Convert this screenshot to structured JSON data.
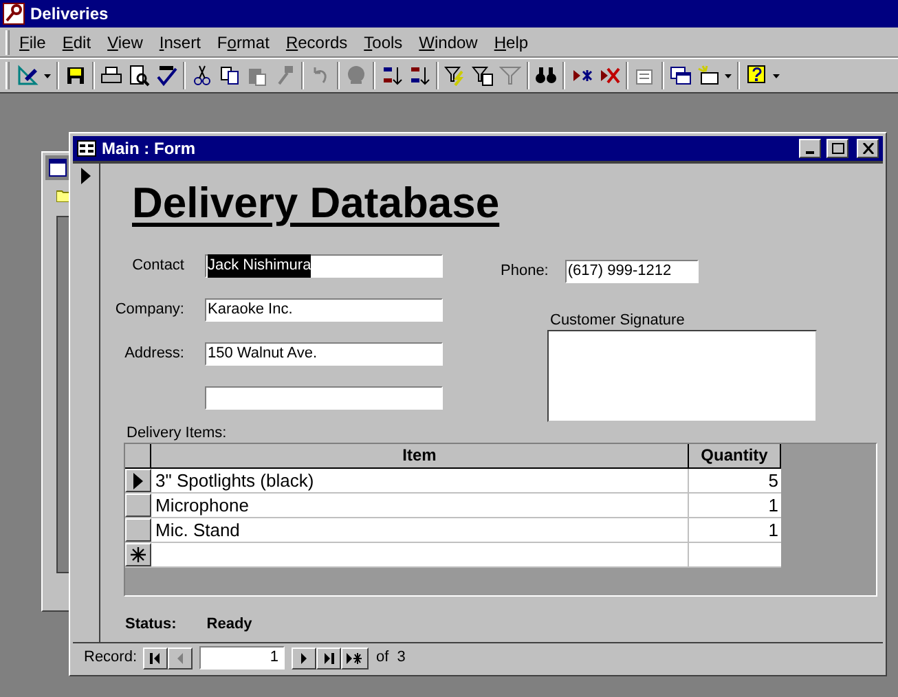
{
  "app": {
    "title": "Deliveries"
  },
  "menu": [
    {
      "accel": "F",
      "after": "ile"
    },
    {
      "accel": "E",
      "after": "dit"
    },
    {
      "accel": "V",
      "after": "iew"
    },
    {
      "accel": "I",
      "after": "nsert"
    },
    {
      "before": "F",
      "accel": "o",
      "after": "rmat"
    },
    {
      "accel": "R",
      "after": "ecords"
    },
    {
      "accel": "T",
      "after": "ools"
    },
    {
      "accel": "W",
      "after": "indow"
    },
    {
      "accel": "H",
      "after": "elp"
    }
  ],
  "toolbar": [
    [
      {
        "kind": "design",
        "disabled": false,
        "menu": true
      }
    ],
    [
      {
        "kind": "save",
        "disabled": false,
        "menu": false
      }
    ],
    [
      {
        "kind": "print",
        "disabled": false,
        "menu": false
      },
      {
        "kind": "preview",
        "disabled": false,
        "menu": false
      },
      {
        "kind": "spelling",
        "disabled": false,
        "menu": false
      }
    ],
    [
      {
        "kind": "cut",
        "disabled": false,
        "menu": false
      },
      {
        "kind": "copy",
        "disabled": false,
        "menu": false
      },
      {
        "kind": "paste",
        "disabled": true,
        "menu": false
      },
      {
        "kind": "painter",
        "disabled": true,
        "menu": false
      }
    ],
    [
      {
        "kind": "undo",
        "disabled": true,
        "menu": false
      }
    ],
    [
      {
        "kind": "hyperlink",
        "disabled": true,
        "menu": false
      }
    ],
    [
      {
        "kind": "sort-asc",
        "disabled": false,
        "menu": false
      },
      {
        "kind": "sort-desc",
        "disabled": false,
        "menu": false
      }
    ],
    [
      {
        "kind": "filter-selection",
        "disabled": false,
        "menu": false
      },
      {
        "kind": "filter-form",
        "disabled": false,
        "menu": false
      },
      {
        "kind": "apply-filter",
        "disabled": true,
        "menu": false
      }
    ],
    [
      {
        "kind": "find",
        "disabled": false,
        "menu": false
      }
    ],
    [
      {
        "kind": "new-record",
        "disabled": false,
        "menu": false
      },
      {
        "kind": "delete-record",
        "disabled": false,
        "menu": false
      }
    ],
    [
      {
        "kind": "properties",
        "disabled": true,
        "menu": false
      }
    ],
    [
      {
        "kind": "database-window",
        "disabled": false,
        "menu": false
      },
      {
        "kind": "new-object",
        "disabled": false,
        "menu": true
      }
    ],
    [
      {
        "kind": "help",
        "disabled": false,
        "menu": true
      }
    ]
  ],
  "form": {
    "title": "Main : Form",
    "current_record": true,
    "heading": "Delivery Database",
    "fields": [
      {
        "kind": "text",
        "label": "Contact",
        "value": "Jack Nishimura",
        "selected": true
      },
      {
        "kind": "text",
        "label": "Company:",
        "value": "Karaoke Inc.",
        "selected": false
      },
      {
        "kind": "text",
        "label": "Address:",
        "value": "150 Walnut Ave.",
        "selected": false
      },
      {
        "kind": "text"
      }
    ],
    "phone": {
      "label": "Phone:",
      "value": "(617) 999-1212"
    },
    "signature": {
      "label": "Customer Signature"
    },
    "items": {
      "label": "Delivery Items:",
      "columns": [
        "Item",
        "Quantity"
      ],
      "rows": [
        {
          "kind": "record",
          "item": "3\" Spotlights (black)",
          "quantity": "5",
          "current": true
        },
        {
          "kind": "record",
          "item": "Microphone",
          "quantity": "1",
          "current": false
        },
        {
          "kind": "record",
          "item": "Mic. Stand",
          "quantity": "1",
          "current": false
        },
        {
          "kind": "new"
        }
      ]
    },
    "status": {
      "label": "Status:",
      "value": "Ready"
    },
    "navigation": {
      "label": "Record:",
      "current": "1",
      "of": "of",
      "total": "3",
      "buttons": [
        {
          "kind": "first",
          "disabled": false
        },
        {
          "kind": "previous",
          "disabled": true
        },
        {
          "kind": "next",
          "disabled": false
        },
        {
          "kind": "last",
          "disabled": false
        },
        {
          "kind": "new",
          "disabled": false
        }
      ]
    }
  }
}
